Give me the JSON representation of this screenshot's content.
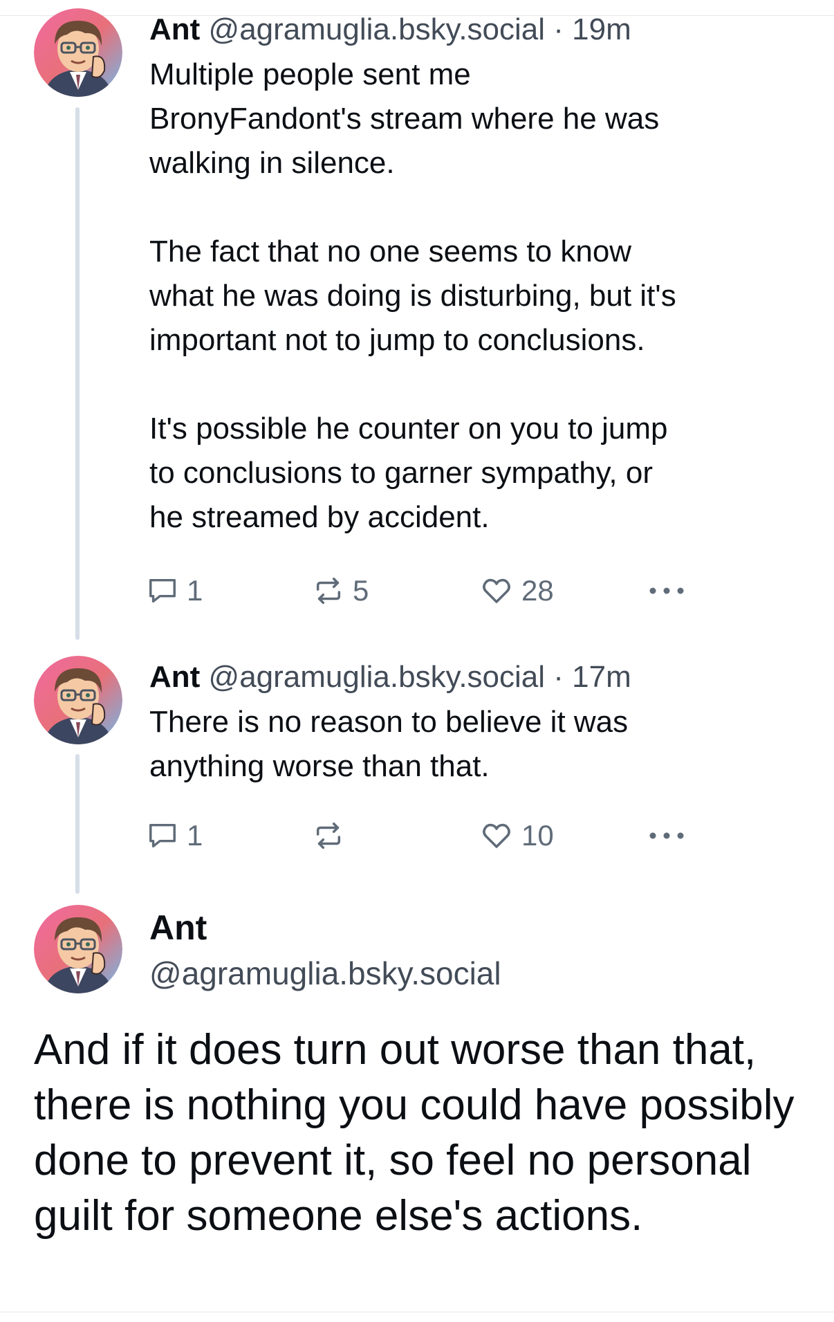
{
  "thread": [
    {
      "author_name": "Ant",
      "handle": "@agramuglia.bsky.social",
      "separator": "·",
      "time": "19m",
      "text": "Multiple people sent me\nBronyFandont's stream where he was\nwalking in silence.\n\nThe fact that no one seems to know\nwhat he was doing is disturbing, but it's\nimportant not to jump to conclusions.\n\nIt's possible he counter on you to jump\nto conclusions to garner sympathy, or\nhe streamed by accident.",
      "reply_count": "1",
      "repost_count": "5",
      "like_count": "28"
    },
    {
      "author_name": "Ant",
      "handle": "@agramuglia.bsky.social",
      "separator": "·",
      "time": "17m",
      "text": "There is no reason to believe it was\nanything worse than that.",
      "reply_count": "1",
      "repost_count": "",
      "like_count": "10"
    }
  ],
  "main_post": {
    "author_name": "Ant",
    "handle": "@agramuglia.bsky.social",
    "text": "And if it does turn out worse than that, there is nothing you could have possibly done to prevent it, so feel no personal guilt for someone else's actions."
  },
  "icons": {
    "reply": "speech-bubble-icon",
    "repost": "repost-arrows-icon",
    "like": "heart-icon",
    "more": "ellipsis-icon"
  },
  "colors": {
    "thread_line": "#d6dee7",
    "meta_text": "#424b57",
    "action_icon": "#5f6b78"
  }
}
